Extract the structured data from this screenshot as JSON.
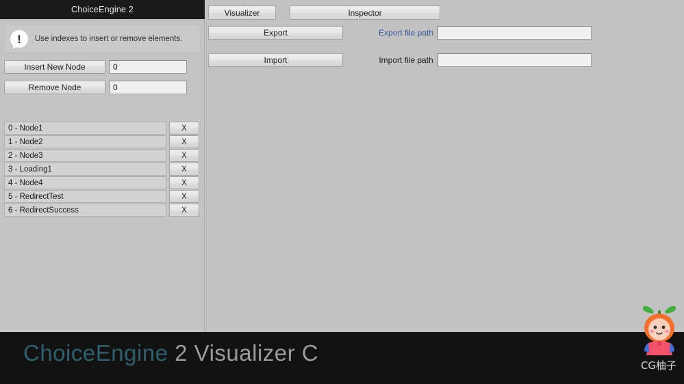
{
  "window": {
    "title": "ChoiceEngine 2"
  },
  "left_panel": {
    "info": {
      "icon": "exclamation-bubble-icon",
      "message": "Use indexes to insert or remove elements."
    },
    "insert": {
      "button_label": "Insert New Node",
      "index_value": "0",
      "placeholder": "0"
    },
    "remove": {
      "button_label": "Remove Node",
      "index_value": "0",
      "placeholder": "0"
    },
    "nodes": [
      {
        "label": "0 - Node1",
        "delete_label": "X"
      },
      {
        "label": "1 - Node2",
        "delete_label": "X"
      },
      {
        "label": "2 - Node3",
        "delete_label": "X"
      },
      {
        "label": "3 - Loading1",
        "delete_label": "X"
      },
      {
        "label": "4 - Node4",
        "delete_label": "X"
      },
      {
        "label": "5 - RedirectTest",
        "delete_label": "X"
      },
      {
        "label": "6 - RedirectSuccess",
        "delete_label": "X"
      }
    ]
  },
  "right_panel": {
    "tabs": [
      {
        "label": "Visualizer"
      },
      {
        "label": "Inspector"
      }
    ],
    "export": {
      "button_label": "Export",
      "path_label": "Export file path",
      "path_value": "",
      "path_label_color": "#3a5a9a"
    },
    "import": {
      "button_label": "Import",
      "path_label": "Import file path",
      "path_value": "",
      "path_label_color": "#1e1e1e"
    }
  },
  "banner": {
    "brand_text": "ChoiceEngine",
    "rest_text": " 2 Visualizer C",
    "brand_color": "#2e5f6e",
    "rest_color": "#9b9b9b"
  },
  "watermark": {
    "icon": "cg-youzi-mascot-icon",
    "text": "CG柚子"
  }
}
